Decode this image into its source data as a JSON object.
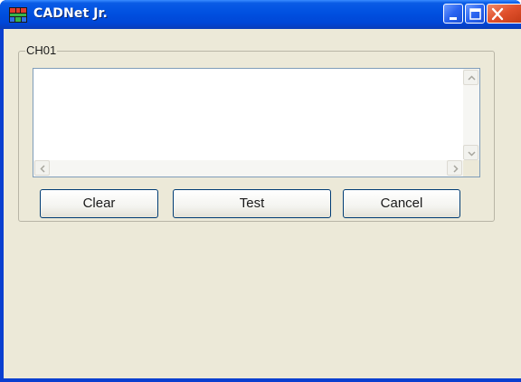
{
  "window": {
    "title": "CADNet Jr.",
    "icon": "cadnet-app-icon",
    "controls": {
      "minimize_icon": "minimize-icon",
      "maximize_icon": "maximize-icon",
      "close_icon": "close-icon"
    }
  },
  "group": {
    "label": "CH01",
    "output_text": ""
  },
  "buttons": {
    "clear_label": "Clear",
    "test_label": "Test",
    "cancel_label": "Cancel"
  },
  "colors": {
    "titlebar": "#0050e0",
    "client_background": "#ece9d8",
    "close_button": "#e0502c",
    "button_border": "#003c74"
  }
}
